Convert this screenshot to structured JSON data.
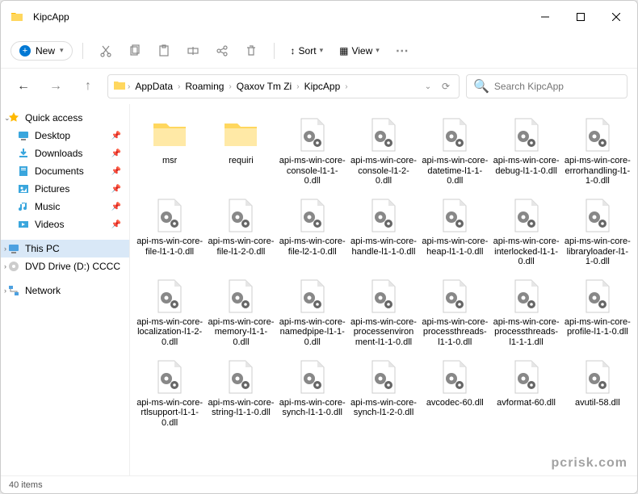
{
  "window": {
    "title": "KipcApp"
  },
  "toolbar": {
    "new_label": "New",
    "sort_label": "Sort",
    "view_label": "View"
  },
  "breadcrumb": {
    "segments": [
      "AppData",
      "Roaming",
      "Qaxov Tm Zi",
      "KipcApp"
    ]
  },
  "search": {
    "placeholder": "Search KipcApp"
  },
  "sidebar": {
    "quick_access": "Quick access",
    "items": [
      {
        "label": "Desktop",
        "icon": "desktop",
        "pinned": true
      },
      {
        "label": "Downloads",
        "icon": "downloads",
        "pinned": true
      },
      {
        "label": "Documents",
        "icon": "documents",
        "pinned": true
      },
      {
        "label": "Pictures",
        "icon": "pictures",
        "pinned": true
      },
      {
        "label": "Music",
        "icon": "music",
        "pinned": true
      },
      {
        "label": "Videos",
        "icon": "videos",
        "pinned": true
      }
    ],
    "this_pc": "This PC",
    "dvd": "DVD Drive (D:) CCCC",
    "network": "Network"
  },
  "files": [
    {
      "name": "msr",
      "type": "folder"
    },
    {
      "name": "requiri",
      "type": "folder"
    },
    {
      "name": "api-ms-win-core-console-l1-1-0.dll",
      "type": "dll"
    },
    {
      "name": "api-ms-win-core-console-l1-2-0.dll",
      "type": "dll"
    },
    {
      "name": "api-ms-win-core-datetime-l1-1-0.dll",
      "type": "dll"
    },
    {
      "name": "api-ms-win-core-debug-l1-1-0.dll",
      "type": "dll"
    },
    {
      "name": "api-ms-win-core-errorhandling-l1-1-0.dll",
      "type": "dll"
    },
    {
      "name": "api-ms-win-core-file-l1-1-0.dll",
      "type": "dll"
    },
    {
      "name": "api-ms-win-core-file-l1-2-0.dll",
      "type": "dll"
    },
    {
      "name": "api-ms-win-core-file-l2-1-0.dll",
      "type": "dll"
    },
    {
      "name": "api-ms-win-core-handle-l1-1-0.dll",
      "type": "dll"
    },
    {
      "name": "api-ms-win-core-heap-l1-1-0.dll",
      "type": "dll"
    },
    {
      "name": "api-ms-win-core-interlocked-l1-1-0.dll",
      "type": "dll"
    },
    {
      "name": "api-ms-win-core-libraryloader-l1-1-0.dll",
      "type": "dll"
    },
    {
      "name": "api-ms-win-core-localization-l1-2-0.dll",
      "type": "dll"
    },
    {
      "name": "api-ms-win-core-memory-l1-1-0.dll",
      "type": "dll"
    },
    {
      "name": "api-ms-win-core-namedpipe-l1-1-0.dll",
      "type": "dll"
    },
    {
      "name": "api-ms-win-core-processenvironment-l1-1-0.dll",
      "type": "dll"
    },
    {
      "name": "api-ms-win-core-processthreads-l1-1-0.dll",
      "type": "dll"
    },
    {
      "name": "api-ms-win-core-processthreads-l1-1-1.dll",
      "type": "dll"
    },
    {
      "name": "api-ms-win-core-profile-l1-1-0.dll",
      "type": "dll"
    },
    {
      "name": "api-ms-win-core-rtlsupport-l1-1-0.dll",
      "type": "dll"
    },
    {
      "name": "api-ms-win-core-string-l1-1-0.dll",
      "type": "dll"
    },
    {
      "name": "api-ms-win-core-synch-l1-1-0.dll",
      "type": "dll"
    },
    {
      "name": "api-ms-win-core-synch-l1-2-0.dll",
      "type": "dll"
    },
    {
      "name": "avcodec-60.dll",
      "type": "dll"
    },
    {
      "name": "avformat-60.dll",
      "type": "dll"
    },
    {
      "name": "avutil-58.dll",
      "type": "dll"
    }
  ],
  "status": {
    "count_label": "40 items"
  },
  "watermark": "pcrisk.com"
}
